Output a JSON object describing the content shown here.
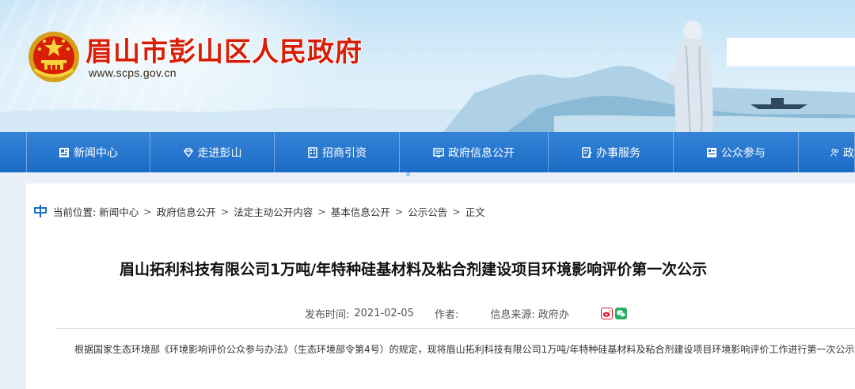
{
  "header": {
    "site_title": "眉山市彭山区人民政府",
    "site_url": "www.scps.gov.cn"
  },
  "nav": {
    "items": [
      {
        "label": "新闻中心",
        "icon": "newspaper-icon"
      },
      {
        "label": "走进彭山",
        "icon": "diamond-icon"
      },
      {
        "label": "招商引资",
        "icon": "building-icon"
      },
      {
        "label": "政府信息公开",
        "icon": "document-list-icon"
      },
      {
        "label": "办事服务",
        "icon": "edit-document-icon"
      },
      {
        "label": "公众参与",
        "icon": "chat-board-icon"
      },
      {
        "label": "政",
        "icon": "people-icon"
      }
    ]
  },
  "breadcrumb": {
    "lead": "当前位置:",
    "items": [
      "新闻中心",
      "政府信息公开",
      "法定主动公开内容",
      "基本信息公开",
      "公示公告",
      "正文"
    ]
  },
  "article": {
    "title": "眉山拓利科技有限公司1万吨/年特种硅基材料及粘合剂建设项目环境影响评价第一次公示",
    "publish_label": "发布时间:",
    "publish_date": "2021-02-05",
    "author_label": "作者:",
    "source_label": "信息来源:",
    "source_value": "政府办",
    "body": "根据国家生态环境部《环境影响评价公众参与办法》（生态环境部令第4号）的规定，现将眉山拓利科技有限公司1万吨/年特种硅基材料及粘合剂建设项目环境影响评价工作进行第一次公示。"
  },
  "colors": {
    "title_red": "#d81e06",
    "nav_blue": "#1b6cc6",
    "weibo": "#e6162d",
    "wechat": "#2aae67"
  }
}
